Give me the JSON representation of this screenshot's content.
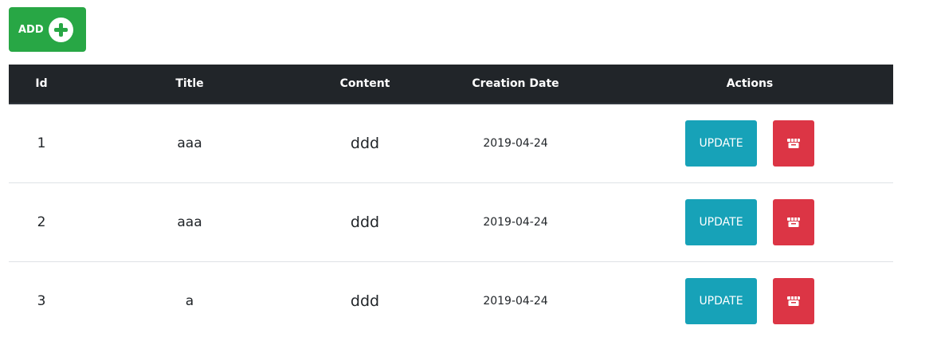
{
  "add_button": {
    "label": "ADD",
    "icon": "plus-circle-icon"
  },
  "table": {
    "headers": {
      "id": "Id",
      "title": "Title",
      "content": "Content",
      "creation_date": "Creation Date",
      "actions": "Actions"
    },
    "rows": [
      {
        "id": "1",
        "title": "aaa",
        "content": "ddd",
        "creation_date": "2019-04-24",
        "update_label": "UPDATE",
        "delete_icon": "dumpster-icon"
      },
      {
        "id": "2",
        "title": "aaa",
        "content": "ddd",
        "creation_date": "2019-04-24",
        "update_label": "UPDATE",
        "delete_icon": "dumpster-icon"
      },
      {
        "id": "3",
        "title": "a",
        "content": "ddd",
        "creation_date": "2019-04-24",
        "update_label": "UPDATE",
        "delete_icon": "dumpster-icon"
      }
    ]
  },
  "colors": {
    "add": "#28a745",
    "header_bg": "#212529",
    "update": "#17a2b8",
    "delete": "#dc3545"
  }
}
